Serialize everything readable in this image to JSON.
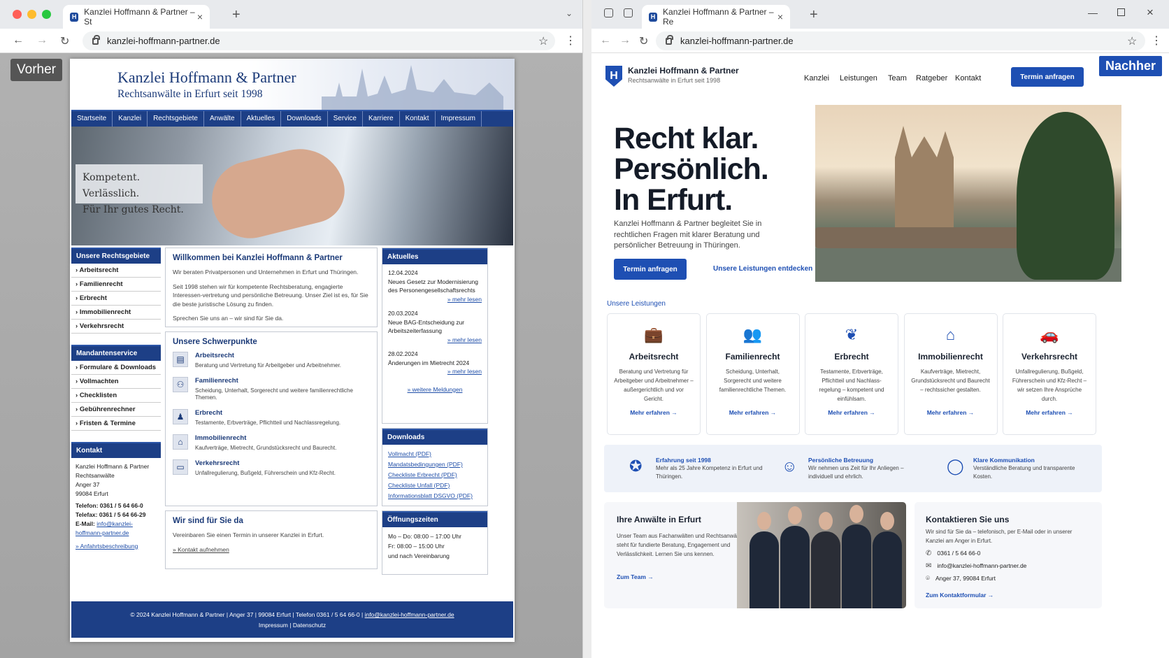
{
  "left": {
    "tab_title": "Kanzlei Hoffmann & Partner – St",
    "url": "kanzlei-hoffmann-partner.de",
    "badge": "Vorher",
    "site": {
      "title": "Kanzlei Hoffmann & Partner",
      "subtitle": "Rechtsanwälte in Erfurt seit 1998",
      "nav": [
        "Startseite",
        "Kanzlei",
        "Rechtsgebiete",
        "Anwälte",
        "Aktuelles",
        "Downloads",
        "Service",
        "Karriere",
        "Kontakt",
        "Impressum"
      ],
      "hero_line1": "Kompetent. Verlässlich.",
      "hero_line2": "Für Ihr gutes Recht.",
      "areas_title": "Unsere Rechtsgebiete",
      "areas": [
        "Arbeitsrecht",
        "Familienrecht",
        "Erbrecht",
        "Immobilienrecht",
        "Verkehrsrecht"
      ],
      "client_title": "Mandantenservice",
      "client": [
        "Formulare & Downloads",
        "Vollmachten",
        "Checklisten",
        "Gebührenrechner",
        "Fristen & Termine"
      ],
      "contact_title": "Kontakt",
      "contact_lines": [
        "Kanzlei Hoffmann & Partner",
        "Rechtsanwälte",
        "Anger 37",
        "99084 Erfurt"
      ],
      "phone": "Telefon: 0361 / 5 64 66-0",
      "fax": "Telefax: 0361 / 5 64 66-29",
      "email_label": "E-Mail:",
      "email": "info@kanzlei-hoffmann-partner.de",
      "directions": "» Anfahrtsbeschreibung",
      "welcome_title": "Willkommen bei Kanzlei Hoffmann & Partner",
      "welcome_p1": "Wir beraten Privatpersonen und Unternehmen in Erfurt und Thüringen.",
      "welcome_p2": "Seit 1998 stehen wir für kompetente Rechtsberatung, engagierte Interessen-vertretung und persönliche Betreuung. Unser Ziel ist es, für Sie die beste juristische Lösung zu finden.",
      "welcome_p3": "Sprechen Sie uns an – wir sind für Sie da.",
      "focus_title": "Unsere Schwerpunkte",
      "focus": [
        {
          "title": "Arbeitsrecht",
          "text": "Beratung und Vertretung für Arbeitgeber und Arbeitnehmer.",
          "icon": "briefcase-icon"
        },
        {
          "title": "Familienrecht",
          "text": "Scheidung, Unterhalt, Sorgerecht und weitere familienrechtliche Themen.",
          "icon": "family-icon"
        },
        {
          "title": "Erbrecht",
          "text": "Testamente, Erbverträge, Pflichtteil und Nachlassregelung.",
          "icon": "person-icon"
        },
        {
          "title": "Immobilienrecht",
          "text": "Kaufverträge, Mietrecht, Grundstücksrecht und Baurecht.",
          "icon": "house-icon"
        },
        {
          "title": "Verkehrsrecht",
          "text": "Unfallregulierung, Bußgeld, Führerschein und Kfz-Recht.",
          "icon": "car-icon"
        }
      ],
      "there_title": "Wir sind für Sie da",
      "there_text": "Vereinbaren Sie einen Termin in unserer Kanzlei in Erfurt.",
      "there_link": "» Kontakt aufnehmen",
      "news_title": "Aktuelles",
      "news": [
        {
          "date": "12.04.2024",
          "text": "Neues Gesetz zur Modernisierung des Personengesellschaftsrechts",
          "more": "» mehr lesen"
        },
        {
          "date": "20.03.2024",
          "text": "Neue BAG-Entscheidung zur Arbeitszeiterfassung",
          "more": "» mehr lesen"
        },
        {
          "date": "28.02.2024",
          "text": "Änderungen im Mietrecht 2024",
          "more": "» mehr lesen"
        }
      ],
      "news_more": "» weitere Meldungen",
      "downloads_title": "Downloads",
      "downloads": [
        "Vollmacht (PDF)",
        "Mandatsbedingungen (PDF)",
        "Checkliste Erbrecht (PDF)",
        "Checkliste Unfall (PDF)",
        "Informationsblatt DSGVO (PDF)"
      ],
      "hours_title": "Öffnungszeiten",
      "hours": [
        "Mo – Do: 08:00 – 17:00 Uhr",
        "Fr: 08:00 – 15:00 Uhr",
        "und nach Vereinbarung"
      ],
      "footer_line": "© 2024 Kanzlei Hoffmann & Partner   |   Anger 37 | 99084 Erfurt   |   Telefon 0361 / 5 64 66-0   |",
      "footer_email": "info@kanzlei-hoffmann-partner.de",
      "footer_links": "Impressum   |   Datenschutz"
    }
  },
  "right": {
    "tab_title": "Kanzlei Hoffmann & Partner – Re",
    "url": "kanzlei-hoffmann-partner.de",
    "badge": "Nachher",
    "site": {
      "logo_letter": "H",
      "name": "Kanzlei Hoffmann & Partner",
      "sub": "Rechtsanwälte in Erfurt seit 1998",
      "nav": [
        "Kanzlei",
        "Leistungen",
        "Team",
        "Ratgeber",
        "Kontakt"
      ],
      "cta": "Termin anfragen",
      "headline1": "Recht klar.",
      "headline2": "Persönlich.",
      "headline3": "In Erfurt.",
      "intro": "Kanzlei Hoffmann & Partner begleitet Sie in rechtlichen Fragen mit klarer Beratung und persönlicher Betreuung in Thüringen.",
      "primary_btn": "Termin anfragen",
      "secondary_link": "Unsere Leistungen entdecken →",
      "services_label": "Unsere Leistungen",
      "services": [
        {
          "title": "Arbeitsrecht",
          "text": "Beratung und Vertretung für Arbeitgeber und Arbeitnehmer – außergerichtlich und vor Gericht.",
          "more": "Mehr erfahren →",
          "icon": "briefcase-icon",
          "glyph": "💼"
        },
        {
          "title": "Familienrecht",
          "text": "Scheidung, Unterhalt, Sorgerecht und weitere familienrechtliche Themen.",
          "more": "Mehr erfahren →",
          "icon": "family-icon",
          "glyph": "👥"
        },
        {
          "title": "Erbrecht",
          "text": "Testamente, Erbverträge, Pflichtteil und Nachlass-regelung – kompetent und einfühlsam.",
          "more": "Mehr erfahren →",
          "icon": "plant-icon",
          "glyph": "❦"
        },
        {
          "title": "Immobilienrecht",
          "text": "Kaufverträge, Mietrecht, Grundstücksrecht und Baurecht – rechtssicher gestalten.",
          "more": "Mehr erfahren →",
          "icon": "house-icon",
          "glyph": "⌂"
        },
        {
          "title": "Verkehrsrecht",
          "text": "Unfallregulierung, Bußgeld, Führerschein und Kfz-Recht – wir setzen Ihre Ansprüche durch.",
          "more": "Mehr erfahren →",
          "icon": "car-icon",
          "glyph": "🚗"
        }
      ],
      "features": [
        {
          "title": "Erfahrung seit 1998",
          "text": "Mehr als 25 Jahre Kompetenz in Erfurt und Thüringen.",
          "icon": "award-icon",
          "glyph": "✪"
        },
        {
          "title": "Persönliche Betreuung",
          "text": "Wir nehmen uns Zeit für Ihr Anliegen – individuell und ehrlich.",
          "icon": "person-icon",
          "glyph": "☺"
        },
        {
          "title": "Klare Kommunikation",
          "text": "Verständliche Beratung und transparente Kosten.",
          "icon": "chat-icon",
          "glyph": "◯"
        }
      ],
      "team_title": "Ihre Anwälte in Erfurt",
      "team_text": "Unser Team aus Fachanwälten und Rechtsanwälten steht für fundierte Beratung, Engagement und Verlässlichkeit. Lernen Sie uns kennen.",
      "team_link": "Zum Team →",
      "contact_title": "Kontaktieren Sie uns",
      "contact_text": "Wir sind für Sie da – telefonisch, per E-Mail oder in unserer Kanzlei am Anger in Erfurt.",
      "phone": "0361 / 5 64 66-0",
      "email": "info@kanzlei-hoffmann-partner.de",
      "address": "Anger 37, 99084 Erfurt",
      "contact_link": "Zum Kontaktformular →"
    }
  }
}
